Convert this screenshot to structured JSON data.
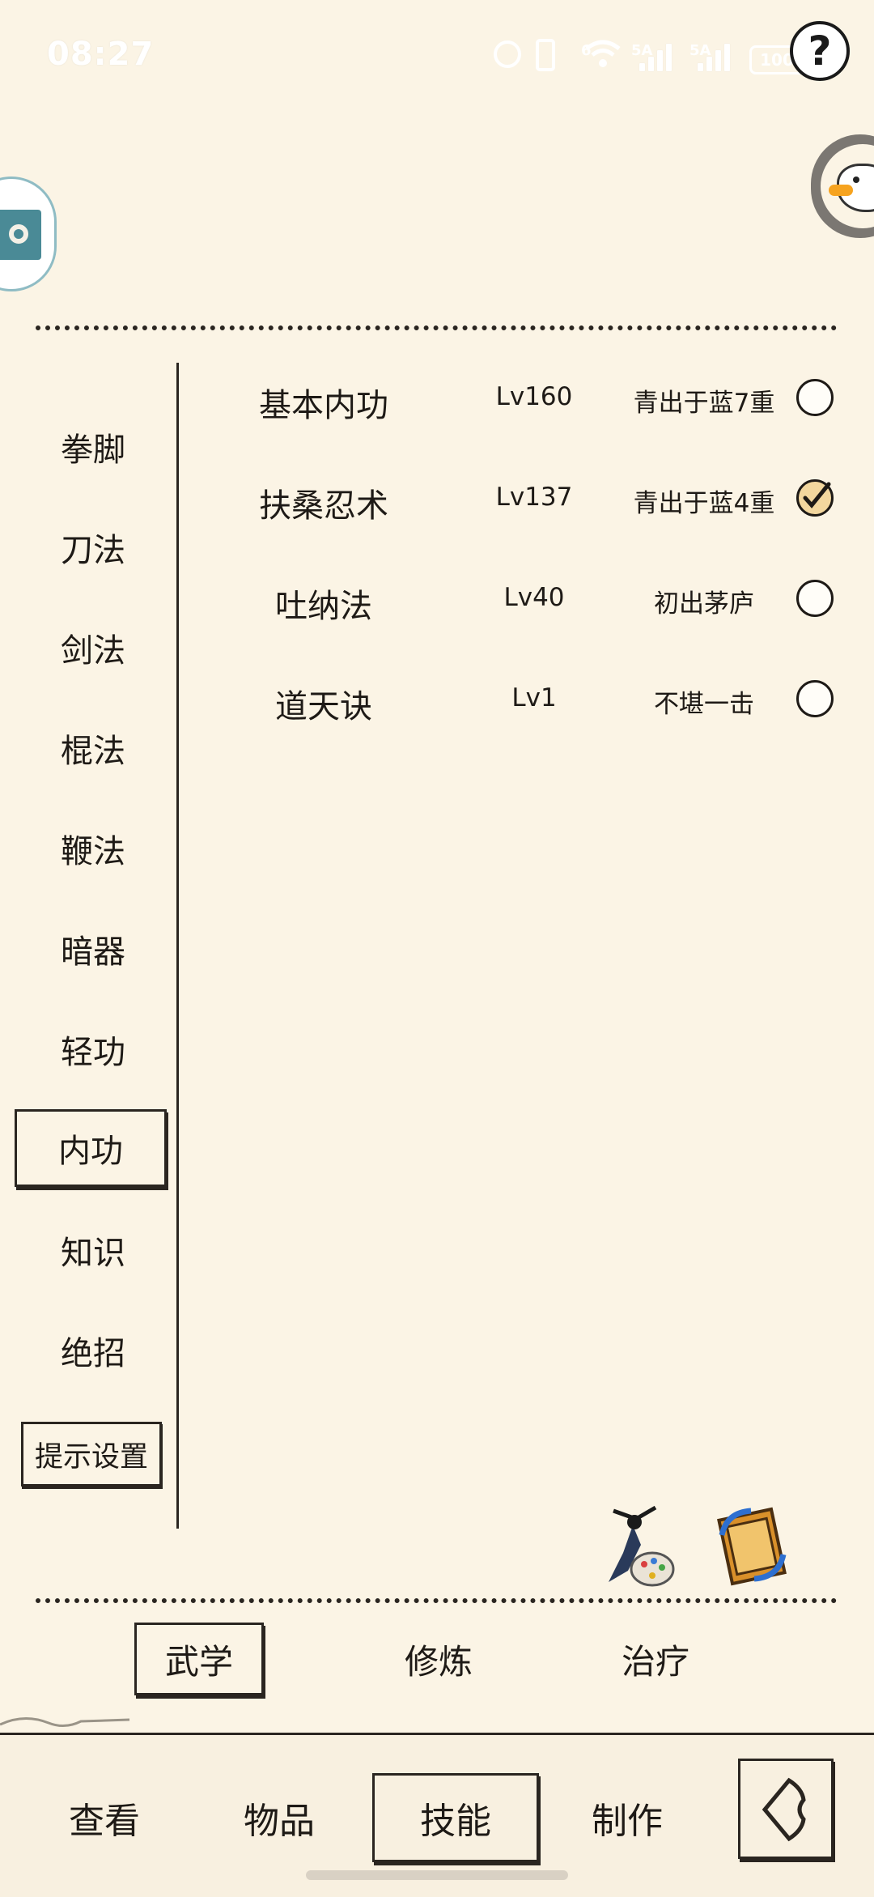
{
  "status_bar": {
    "time": "08:27",
    "net_a": "6",
    "net_b": "5A",
    "net_c": "5A",
    "battery": "100"
  },
  "sidebar": {
    "categories": [
      "拳脚",
      "刀法",
      "剑法",
      "棍法",
      "鞭法",
      "暗器",
      "轻功",
      "内功",
      "知识",
      "绝招"
    ],
    "active": "内功",
    "hint_label": "提示设置"
  },
  "skills": [
    {
      "name": "基本内功",
      "level": "Lv160",
      "rank": "青出于蓝7重",
      "selected": false
    },
    {
      "name": "扶桑忍术",
      "level": "Lv137",
      "rank": "青出于蓝4重",
      "selected": true
    },
    {
      "name": "吐纳法",
      "level": "Lv40",
      "rank": "初出茅庐",
      "selected": false
    },
    {
      "name": "道天诀",
      "level": "Lv1",
      "rank": "不堪一击",
      "selected": false
    }
  ],
  "subtabs": {
    "items": [
      "武学",
      "修炼",
      "治疗"
    ],
    "active": "武学"
  },
  "bottom_nav": {
    "items": [
      "查看",
      "物品",
      "技能",
      "制作"
    ],
    "active": "技能"
  },
  "colors": {
    "background": "#fbf4e5",
    "ink": "#1e1a16",
    "checked_fill": "#f3d79e"
  },
  "icons": {
    "help": "question-mark-icon",
    "left_float": "game-logo-icon",
    "right_float": "duck-avatar-icon",
    "tool1": "warrior-palette-icon",
    "tool2": "book-swap-icon",
    "back": "back-arrow-icon"
  }
}
